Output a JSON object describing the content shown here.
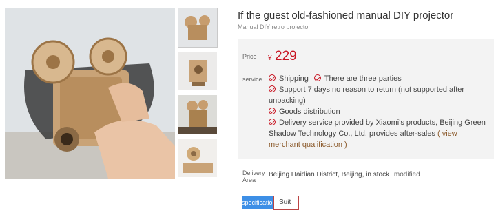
{
  "product": {
    "title": "If the guest old-fashioned manual DIY projector",
    "subtitle": "Manual DIY retro projector"
  },
  "price": {
    "label": "Price",
    "currency": "¥",
    "value": "229"
  },
  "service": {
    "label": "service",
    "items": [
      "Shipping",
      "There are three parties",
      "Support 7 days no reason to return (not supported after unpacking)",
      "Goods distribution",
      "Delivery service provided by Xiaomi's products, Beijing Green Shadow Technology Co., Ltd. provides after-sales"
    ],
    "merchant_link": "( view merchant qualification )"
  },
  "delivery": {
    "label": "Delivery Area",
    "location": "Beijing Haidian District, Beijing,",
    "stock": "in stock",
    "modified": "modified"
  },
  "specification": {
    "label": "specification",
    "selected": "Suit"
  },
  "colors": {
    "price_red": "#c81623",
    "spec_blue": "#3d8fe6",
    "panel_bg": "#f3f3f3"
  }
}
